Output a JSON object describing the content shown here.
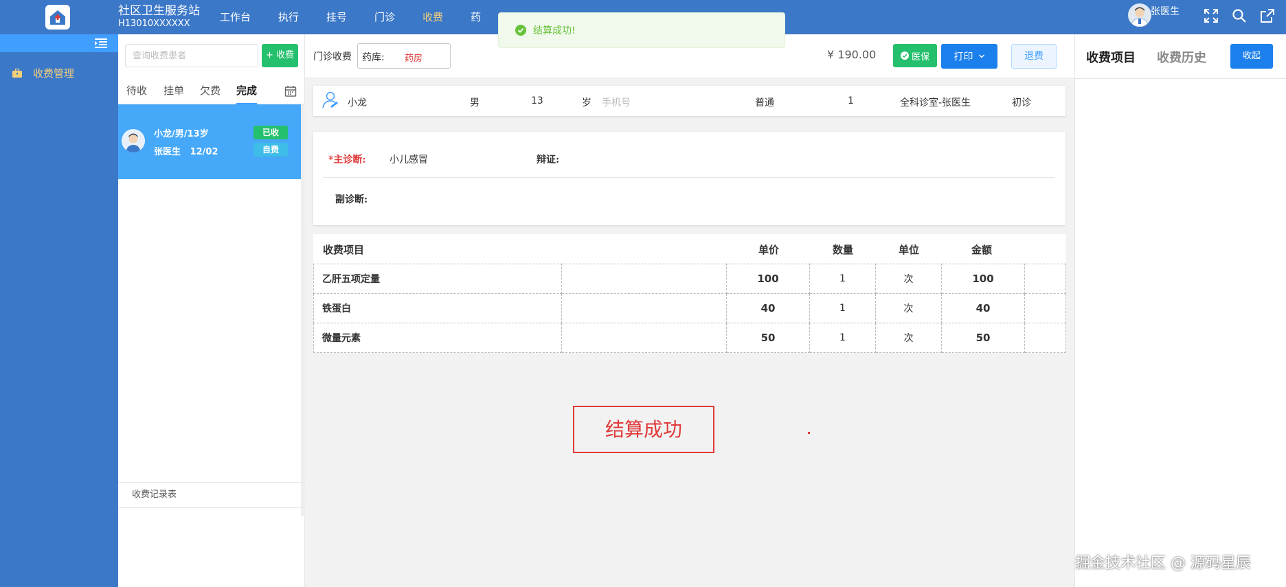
{
  "header": {
    "site_name": "社区卫生服务站",
    "site_code": "H13010XXXXXX",
    "nav": [
      "工作台",
      "执行",
      "挂号",
      "门诊",
      "收费",
      "药"
    ],
    "active_nav": "收费",
    "user_name": "张医生"
  },
  "toast": {
    "text": "结算成功!"
  },
  "sidebar": {
    "item": "收费管理"
  },
  "patient_list": {
    "search_placeholder": "查询收费患者",
    "charge_button": "+ 收费",
    "tabs": [
      "待收",
      "挂单",
      "欠费",
      "完成"
    ],
    "active_tab": "完成",
    "card": {
      "line1": "小龙/男/13岁",
      "doctor": "张医生",
      "date": "12/02",
      "status": "已收",
      "pay_type": "自费"
    },
    "records_label": "收费记录表"
  },
  "main": {
    "label": "门诊收费",
    "pharmacy_key": "药库:",
    "pharmacy_value": "药房",
    "total": "¥ 190.00",
    "insurance_button": "医保",
    "print_button": "打印",
    "refund_button": "退费"
  },
  "patient_info": {
    "name": "小龙",
    "gender": "男",
    "age": "13",
    "age_unit": "岁",
    "phone_placeholder": "手机号",
    "visit_type": "普通",
    "visit_no": "1",
    "department": "全科诊室-张医生",
    "visit_kind": "初诊"
  },
  "diagnosis": {
    "main_label": "*主诊断:",
    "main_value": "小儿感冒",
    "syndrome_label": "辩证:",
    "secondary_label": "副诊断:"
  },
  "fee_table": {
    "headers": {
      "item": "收费项目",
      "price": "单价",
      "qty": "数量",
      "unit": "单位",
      "amount": "金额"
    },
    "rows": [
      {
        "item": "乙肝五项定量",
        "price": "100",
        "qty": "1",
        "unit": "次",
        "amount": "100"
      },
      {
        "item": "铁蛋白",
        "price": "40",
        "qty": "1",
        "unit": "次",
        "amount": "40"
      },
      {
        "item": "微量元素",
        "price": "50",
        "qty": "1",
        "unit": "次",
        "amount": "50"
      }
    ]
  },
  "stamp": {
    "text": "结算成功"
  },
  "right_panel": {
    "tab_items": "收费项目",
    "tab_history": "收费历史",
    "collapse_button": "收起"
  },
  "watermark": "掘金技术社区 @ 源码星辰",
  "colors": {
    "primary": "#3c78c8",
    "accent": "#409eff",
    "success": "#25c06d",
    "danger": "#e03a3a",
    "nav_active": "#f4cf7a"
  }
}
